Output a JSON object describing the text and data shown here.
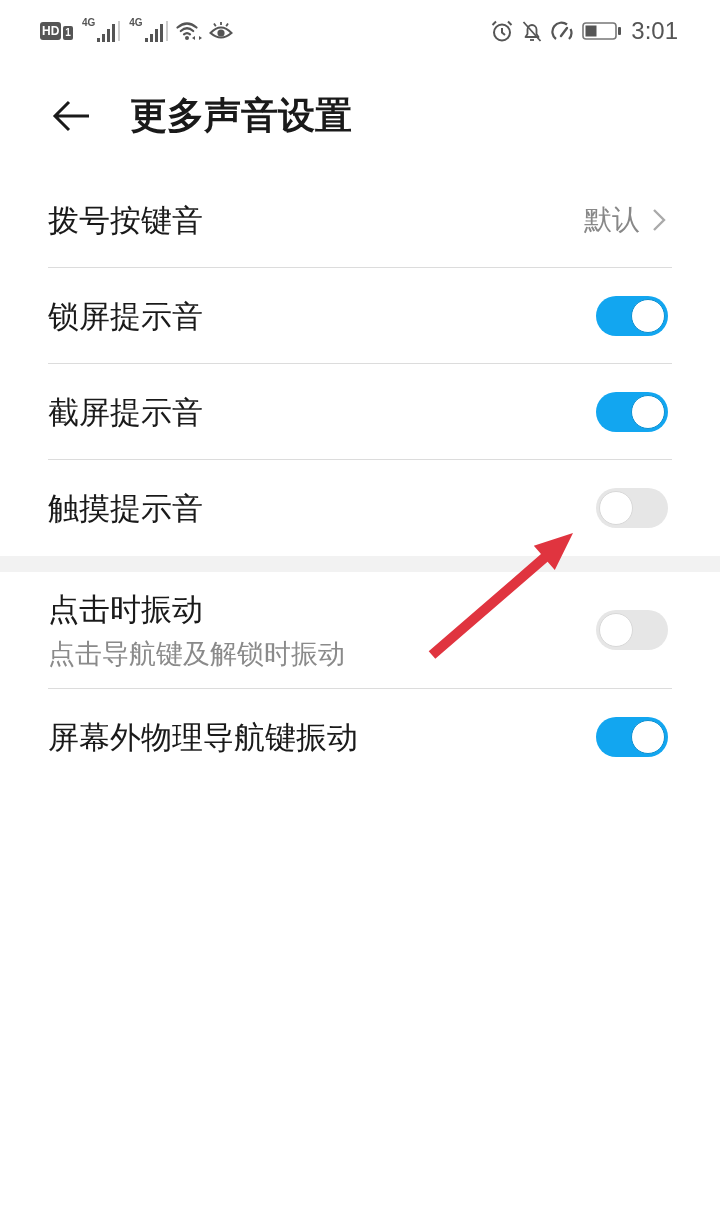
{
  "status_bar": {
    "hd_badge": "HD",
    "sim_badge": "1",
    "signals": [
      {
        "label": "4G"
      },
      {
        "label": "4G"
      }
    ],
    "time": "3:01"
  },
  "header": {
    "title": "更多声音设置"
  },
  "sections": [
    {
      "rows": [
        {
          "kind": "link",
          "label": "拨号按键音",
          "value": "默认",
          "pointed_at": false
        },
        {
          "kind": "toggle",
          "label": "锁屏提示音",
          "on": true,
          "pointed_at": false
        },
        {
          "kind": "toggle",
          "label": "截屏提示音",
          "on": true,
          "pointed_at": false
        },
        {
          "kind": "toggle",
          "label": "触摸提示音",
          "on": false,
          "pointed_at": true
        }
      ]
    },
    {
      "rows": [
        {
          "kind": "toggle",
          "label": "点击时振动",
          "sublabel": "点击导航键及解锁时振动",
          "on": false,
          "pointed_at": false
        },
        {
          "kind": "toggle",
          "label": "屏幕外物理导航键振动",
          "on": true,
          "pointed_at": false
        }
      ]
    }
  ]
}
